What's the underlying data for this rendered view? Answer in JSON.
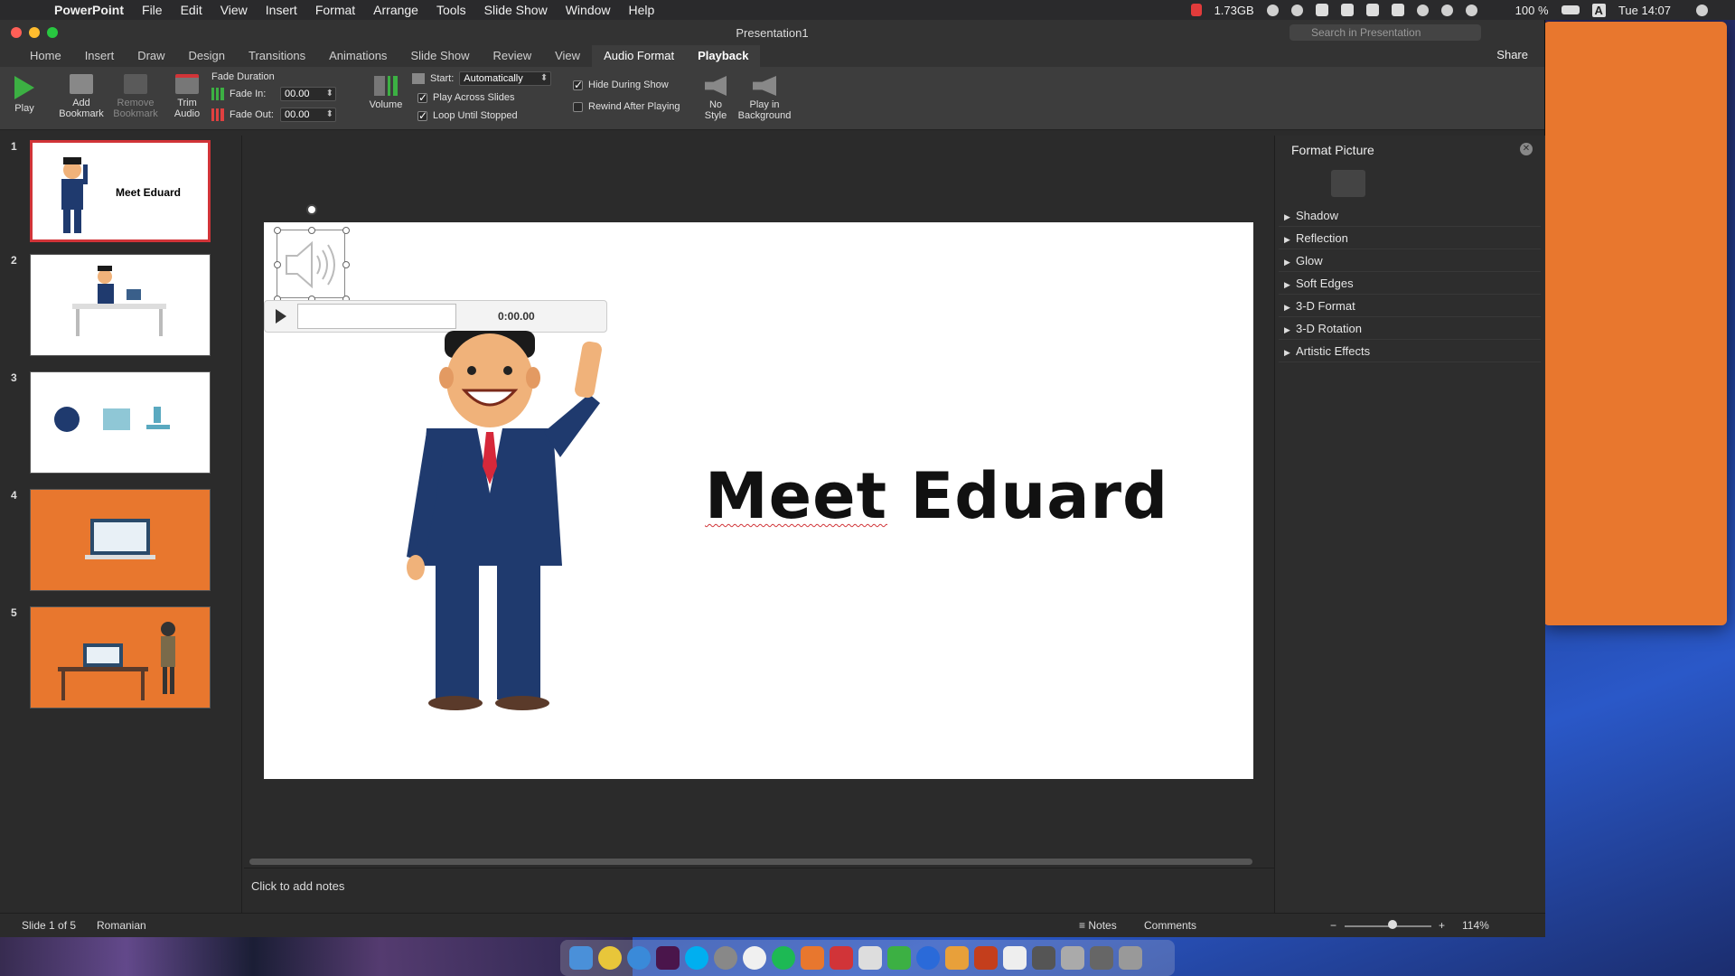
{
  "menubar": {
    "app": "PowerPoint",
    "items": [
      "File",
      "Edit",
      "View",
      "Insert",
      "Format",
      "Arrange",
      "Tools",
      "Slide Show",
      "Window",
      "Help"
    ],
    "memory": "1.73GB",
    "battery": "100 %",
    "input_source": "A",
    "clock": "Tue 14:07"
  },
  "window": {
    "title": "Presentation1",
    "search_placeholder": "Search in Presentation",
    "share_label": "Share"
  },
  "tabs": [
    "Home",
    "Insert",
    "Draw",
    "Design",
    "Transitions",
    "Animations",
    "Slide Show",
    "Review",
    "View",
    "Audio Format",
    "Playback"
  ],
  "active_tab": "Playback",
  "ribbon": {
    "play": "Play",
    "add_bookmark_1": "Add",
    "add_bookmark_2": "Bookmark",
    "remove_bookmark_1": "Remove",
    "remove_bookmark_2": "Bookmark",
    "trim_1": "Trim",
    "trim_2": "Audio",
    "fade_duration": "Fade Duration",
    "fade_in_label": "Fade In:",
    "fade_in_value": "00.00",
    "fade_out_label": "Fade Out:",
    "fade_out_value": "00.00",
    "volume": "Volume",
    "start_label": "Start:",
    "start_value": "Automatically",
    "play_across_slides": "Play Across Slides",
    "loop_until_stopped": "Loop Until Stopped",
    "hide_during_show": "Hide During Show",
    "rewind_after_playing": "Rewind After Playing",
    "no_style_1": "No",
    "no_style_2": "Style",
    "play_bg_1": "Play in",
    "play_bg_2": "Background"
  },
  "slides": [
    {
      "num": "1",
      "text": "Meet Eduard"
    },
    {
      "num": "2"
    },
    {
      "num": "3"
    },
    {
      "num": "4"
    },
    {
      "num": "5"
    }
  ],
  "slide": {
    "title_word1": "Meet",
    "title_word2": "Eduard",
    "player_time": "0:00.00"
  },
  "notes_placeholder": "Click to add notes",
  "pane": {
    "title": "Format Picture",
    "sections": [
      "Shadow",
      "Reflection",
      "Glow",
      "Soft Edges",
      "3-D Format",
      "3-D Rotation",
      "Artistic Effects"
    ]
  },
  "status": {
    "slide_info": "Slide 1 of 5",
    "language": "Romanian",
    "notes": "Notes",
    "comments": "Comments",
    "zoom": "114%",
    "zoom_level": 0.55
  },
  "colors": {
    "accent_green": "#3cb043",
    "selection_red": "#d13438",
    "slide_orange": "#e8772e"
  }
}
